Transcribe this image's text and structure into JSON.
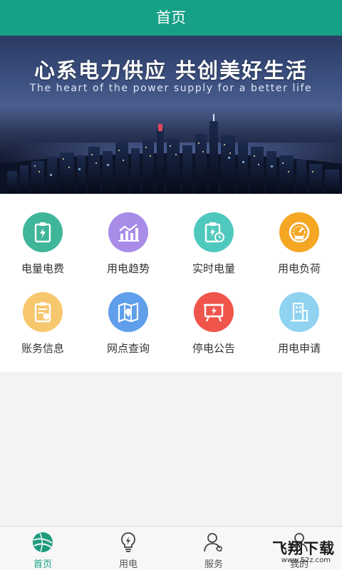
{
  "header": {
    "title": "首页"
  },
  "banner": {
    "title": "心系电力供应 共创美好生活",
    "subtitle": "The heart of the power supply for a better life",
    "dots": 3,
    "active_dot": 2
  },
  "services": [
    {
      "label": "电量电费",
      "icon": "bill-receipt-icon",
      "color": "#3fb59a"
    },
    {
      "label": "用电趋势",
      "icon": "trend-chart-icon",
      "color": "#a98ce8"
    },
    {
      "label": "实时电量",
      "icon": "clipboard-clock-icon",
      "color": "#4fc9bd"
    },
    {
      "label": "用电负荷",
      "icon": "gauge-icon",
      "color": "#f5a623"
    },
    {
      "label": "账务信息",
      "icon": "account-receipt-icon",
      "color": "#f7c76d"
    },
    {
      "label": "网点查询",
      "icon": "map-pin-icon",
      "color": "#5f9eea"
    },
    {
      "label": "停电公告",
      "icon": "notice-board-icon",
      "color": "#f0554c"
    },
    {
      "label": "用电申请",
      "icon": "building-apply-icon",
      "color": "#8fd3f0"
    }
  ],
  "tabbar": {
    "tabs": [
      {
        "label": "首页",
        "icon": "globe-icon",
        "active": true
      },
      {
        "label": "用电",
        "icon": "lightbulb-icon",
        "active": false
      },
      {
        "label": "服务",
        "icon": "customer-service-icon",
        "active": false
      },
      {
        "label": "我的",
        "icon": "user-icon",
        "active": false
      }
    ],
    "active_color": "#16a085"
  },
  "watermark": {
    "main": "飞翔下载",
    "sub": "www.52z.com"
  }
}
